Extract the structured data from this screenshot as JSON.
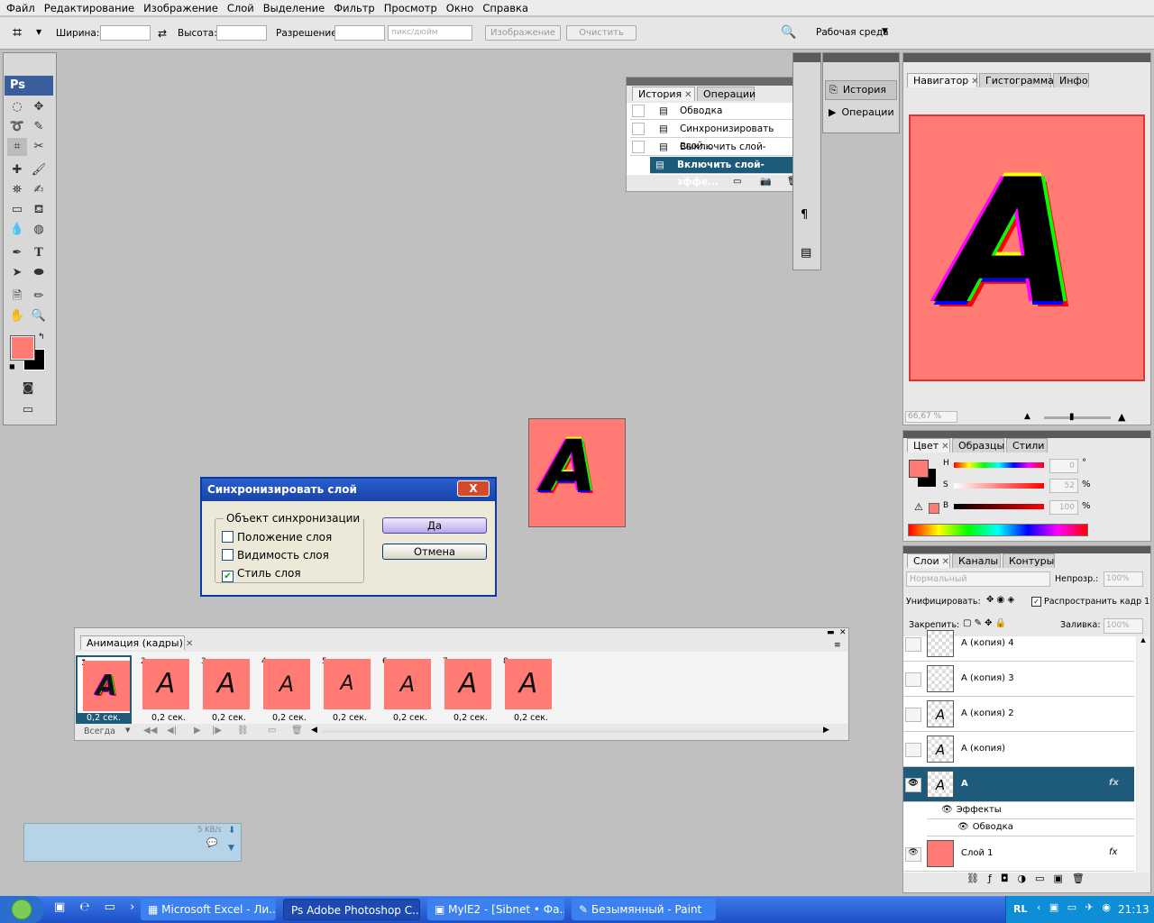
{
  "menu": [
    "Файл",
    "Редактирование",
    "Изображение",
    "Слой",
    "Выделение",
    "Фильтр",
    "Просмотр",
    "Окно",
    "Справка"
  ],
  "options": {
    "width_label": "Ширина:",
    "height_label": "Высота:",
    "resolution_label": "Разрешение:",
    "unit_value": "пикс/дюйм",
    "image_button": "Изображение",
    "clear_button": "Очистить",
    "workspace": "Рабочая среда"
  },
  "toolbox": {
    "badge": "Ps",
    "fg_color": "#ff7b73",
    "bg_color": "#000000"
  },
  "history_panel": {
    "tabs": [
      "История",
      "Операции"
    ],
    "items": [
      {
        "label": "Обводка",
        "selected": false
      },
      {
        "label": "Синхронизировать слой...",
        "selected": false
      },
      {
        "label": "Выключить слой-эффект...",
        "selected": false
      },
      {
        "label": "Включить слой-эффе...",
        "selected": true
      }
    ]
  },
  "dock_icons": {
    "history": "История",
    "actions": "Операции"
  },
  "navigator": {
    "tabs": [
      "Навигатор",
      "Гистограмма",
      "Инфо"
    ],
    "zoom": "66,67 %"
  },
  "color_panel": {
    "tabs": [
      "Цвет",
      "Образцы",
      "Стили"
    ],
    "h_label": "H",
    "s_label": "S",
    "b_label": "B",
    "h_value": "0",
    "s_value": "52",
    "b_value": "100",
    "deg": "°",
    "pct1": "%",
    "pct2": "%"
  },
  "layers_panel": {
    "tabs": [
      "Слои",
      "Каналы",
      "Контуры"
    ],
    "blend_mode": "Нормальный",
    "opacity_label": "Непрозр.:",
    "opacity_value": "100%",
    "unify_label": "Унифицировать:",
    "propagate_label": "Распространить кадр 1",
    "lock_label": "Закрепить:",
    "fill_label": "Заливка:",
    "fill_value": "100%",
    "layers": [
      "А (копия) 4",
      "А (копия) 3",
      "А (копия) 2",
      "А (копия)",
      "А"
    ],
    "effects_label": "Эффекты",
    "stroke_label": "Обводка",
    "bottom_layer": "Слой 1",
    "fx": "fx"
  },
  "canvas": {
    "letter": "A",
    "bg": "#ff7b73"
  },
  "dialog": {
    "title": "Синхронизировать слой",
    "group": "Объект синхронизации",
    "opt_position": "Положение слоя",
    "opt_visibility": "Видимость слоя",
    "opt_style": "Стиль слоя",
    "style_checked": true,
    "ok": "Да",
    "cancel": "Отмена",
    "close": "X"
  },
  "animation": {
    "tab": "Анимация (кадры)",
    "loop": "Всегда",
    "frames": [
      {
        "n": "1",
        "dur": "0,2 сек."
      },
      {
        "n": "2",
        "dur": "0,2 сек."
      },
      {
        "n": "3",
        "dur": "0,2 сек."
      },
      {
        "n": "4",
        "dur": "0,2 сек."
      },
      {
        "n": "5",
        "dur": "0,2 сек."
      },
      {
        "n": "6",
        "dur": "0,2 сек."
      },
      {
        "n": "7",
        "dur": "0,2 сек."
      },
      {
        "n": "8",
        "dur": "0,2 сек."
      }
    ]
  },
  "net_widget": {
    "speed": "5 KB/s"
  },
  "taskbar": {
    "items": [
      "Microsoft Excel - Ли...",
      "Adobe Photoshop C...",
      "MylE2 - [Sibnet • Фа...",
      "Безымянный - Paint"
    ],
    "lang": "RL",
    "clock": "21:13"
  }
}
